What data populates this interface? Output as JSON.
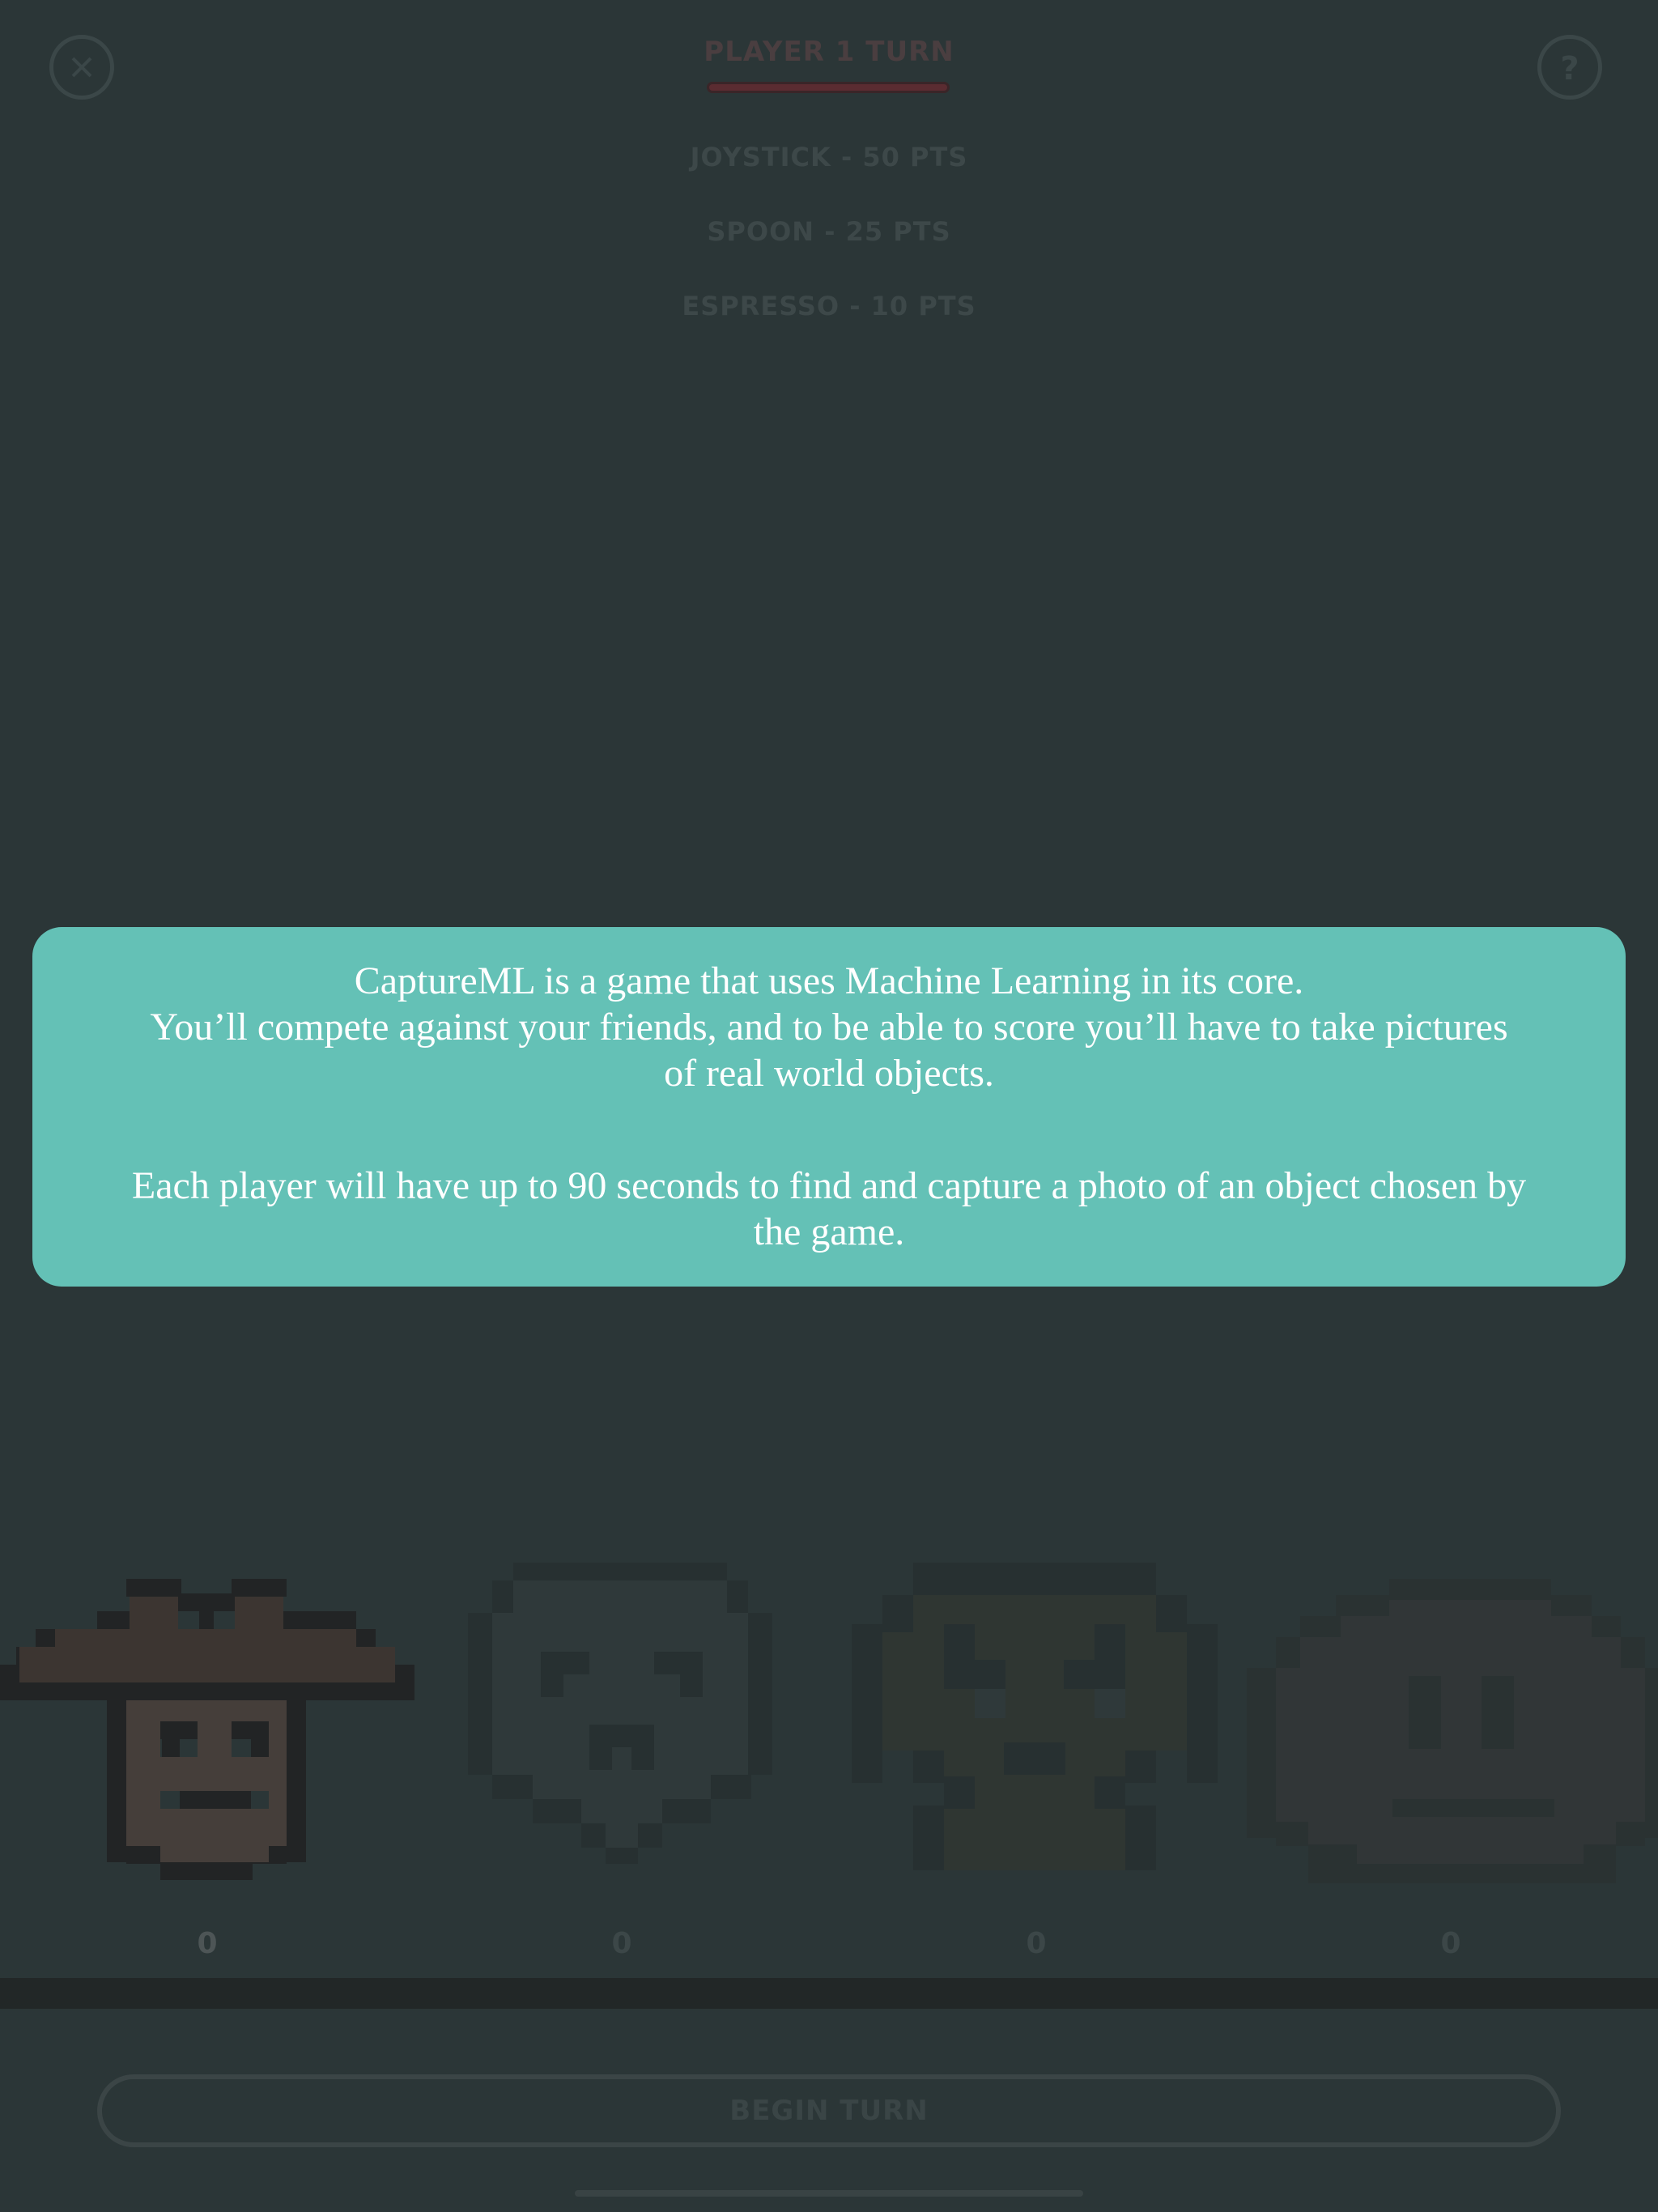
{
  "header": {
    "turn_title": "PLAYER 1 TURN",
    "close_icon": "close-icon",
    "help_icon": "question-icon",
    "help_glyph": "?"
  },
  "objectives": [
    {
      "label": "JOYSTICK - 50 PTS"
    },
    {
      "label": "SPOON - 25 PTS"
    },
    {
      "label": "ESPRESSO - 10 PTS"
    }
  ],
  "dialog": {
    "paragraph_1": "CaptureML is a game that uses Machine Learning in its core.\nYou’ll compete against your friends, and to be able to score you’ll have to take pictures of real world objects.",
    "paragraph_2": "Each player will have up to 90 seconds to find and capture a photo of an object chosen by the game."
  },
  "players": [
    {
      "avatar": "pirate-avatar",
      "score": "0",
      "active": true
    },
    {
      "avatar": "alien-avatar",
      "score": "0",
      "active": false
    },
    {
      "avatar": "robot-avatar",
      "score": "0",
      "active": false
    },
    {
      "avatar": "blob-avatar",
      "score": "0",
      "active": false
    }
  ],
  "footer": {
    "begin_label": "BEGIN TURN"
  },
  "colors": {
    "background": "#2b3637",
    "dialog": "#64c1b6",
    "turn_bar": "#5a2c31"
  }
}
